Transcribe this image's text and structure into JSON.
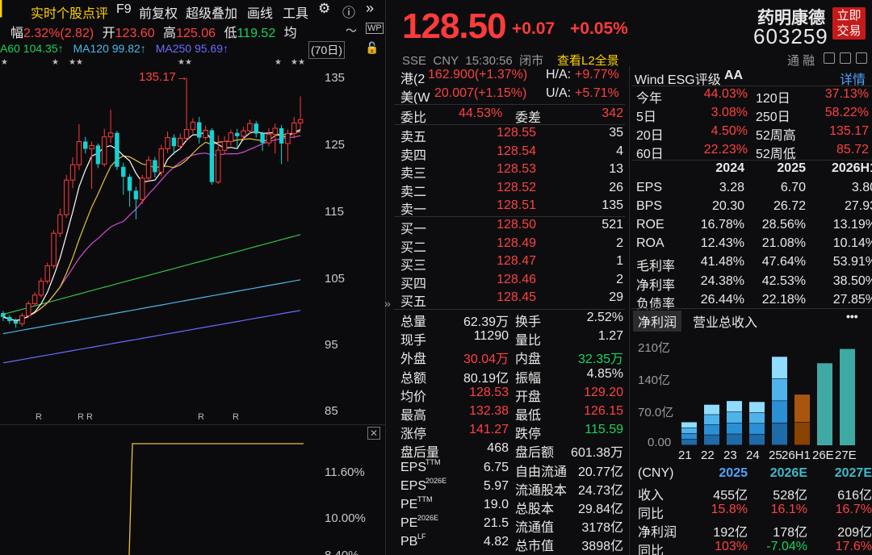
{
  "toolbar": {
    "items": [
      "实时个股点评",
      "F9",
      "前复权",
      "超级叠加",
      "画线",
      "工具"
    ]
  },
  "chart_info": {
    "change_label": "幅",
    "change_value": "2.32%(2.82)",
    "open_label": "开",
    "open_value": "123.60",
    "high_label": "高",
    "high_value": "125.06",
    "low_label": "低",
    "low_value": "119.52",
    "avg_label": "均",
    "ma60": "A60 104.35↑",
    "ma120": "MA120 99.82↑",
    "ma250": "MA250 95.69↑",
    "period": "(70日)",
    "annotation": "135.17→",
    "y_ticks": [
      "135",
      "125",
      "115",
      "105",
      "95",
      "85"
    ],
    "r_marks": [
      "R",
      "R",
      "R",
      "R",
      "R"
    ],
    "lower_ticks": [
      "11.60%",
      "10.00%",
      "8.40%"
    ],
    "star": "★",
    "star2": "★★",
    "colors": {
      "ma5": "#ffffff",
      "ma10": "#e8c23b",
      "ma20": "#d84cd8",
      "ma60": "#33c04a",
      "ma120": "#4ab8e8",
      "ma250": "#6a6aff",
      "up": "#ff3b3b",
      "down": "#16d1d1"
    }
  },
  "quote": {
    "price": "128.50",
    "change": "+0.07",
    "pct": "+0.05%",
    "name": "药明康德",
    "code": "603259",
    "trade_btn": "立即交易",
    "exchange": "SSE",
    "currency": "CNY",
    "time": "15:30:56",
    "status": "闭市",
    "l2": "查看L2全景",
    "tonghrong": "通 融",
    "hk_label": "港(2",
    "hk_value": "162.900(+1.37%)",
    "ha_label": "H/A:",
    "ha_value": "+9.77%",
    "us_label": "美(W",
    "us_value": "20.007(+1.15%)",
    "ua_label": "U/A:",
    "ua_value": "+5.71%",
    "weibi_label": "委比",
    "weibi_value": "44.53%",
    "weicha_label": "委差",
    "weicha_value": "342",
    "asks": [
      {
        "label": "卖五",
        "price": "128.55",
        "vol": "35"
      },
      {
        "label": "卖四",
        "price": "128.54",
        "vol": "4"
      },
      {
        "label": "卖三",
        "price": "128.53",
        "vol": "13"
      },
      {
        "label": "卖二",
        "price": "128.52",
        "vol": "26"
      },
      {
        "label": "卖一",
        "price": "128.51",
        "vol": "135"
      }
    ],
    "bids": [
      {
        "label": "买一",
        "price": "128.50",
        "vol": "521"
      },
      {
        "label": "买二",
        "price": "128.49",
        "vol": "2"
      },
      {
        "label": "买三",
        "price": "128.47",
        "vol": "1"
      },
      {
        "label": "买四",
        "price": "128.46",
        "vol": "2"
      },
      {
        "label": "买五",
        "price": "128.45",
        "vol": "29"
      }
    ],
    "stats": [
      {
        "l1": "总量",
        "v1": "62.39万",
        "c1": "white",
        "l2": "换手",
        "v2": "2.52%",
        "c2": "white"
      },
      {
        "l1": "现手",
        "v1": "11290",
        "c1": "white",
        "l2": "量比",
        "v2": "1.27",
        "c2": "white"
      },
      {
        "l1": "外盘",
        "v1": "30.04万",
        "c1": "red",
        "l2": "内盘",
        "v2": "32.35万",
        "c2": "green"
      },
      {
        "l1": "总额",
        "v1": "80.19亿",
        "c1": "white",
        "l2": "振幅",
        "v2": "4.85%",
        "c2": "white"
      },
      {
        "l1": "均价",
        "v1": "128.53",
        "c1": "red",
        "l2": "开盘",
        "v2": "129.20",
        "c2": "red"
      },
      {
        "l1": "最高",
        "v1": "132.38",
        "c1": "red",
        "l2": "最低",
        "v2": "126.15",
        "c2": "red"
      },
      {
        "l1": "涨停",
        "v1": "141.27",
        "c1": "red",
        "l2": "跌停",
        "v2": "115.59",
        "c2": "green"
      },
      {
        "l1": "盘后量",
        "v1": "468",
        "c1": "white",
        "l2": "盘后额",
        "v2": "601.38万",
        "c2": "white"
      },
      {
        "l1": "EPS",
        "s1": "TTM",
        "v1": "6.75",
        "c1": "white",
        "l2": "自由流通",
        "v2": "20.77亿",
        "c2": "white"
      },
      {
        "l1": "EPS",
        "s1": "2026E",
        "v1": "5.97",
        "c1": "white",
        "l2": "流通股本",
        "v2": "24.73亿",
        "c2": "white"
      },
      {
        "l1": "PE",
        "s1": "TTM",
        "v1": "19.0",
        "c1": "white",
        "l2": "总股本",
        "v2": "29.84亿",
        "c2": "white"
      },
      {
        "l1": "PE",
        "s1": "2026E",
        "v1": "21.5",
        "c1": "white",
        "l2": "流通值",
        "v2": "3178亿",
        "c2": "white"
      },
      {
        "l1": "PB",
        "s1": "LF",
        "v1": "4.82",
        "c1": "white",
        "l2": "总市值",
        "v2": "3898亿",
        "c2": "white"
      }
    ]
  },
  "fundamentals": {
    "esg_label": "Wind ESG评级",
    "esg_value": "AA",
    "detail": "详情",
    "returns": [
      {
        "l1": "今年",
        "v1": "44.03%",
        "l2": "120日",
        "v2": "37.13%"
      },
      {
        "l1": "5日",
        "v1": "3.08%",
        "l2": "250日",
        "v2": "58.22%"
      },
      {
        "l1": "20日",
        "v1": "4.50%",
        "l2": "52周高",
        "v2": "135.17"
      },
      {
        "l1": "60日",
        "v1": "22.23%",
        "l2": "52周低",
        "v2": "85.72"
      }
    ],
    "years": [
      "2024",
      "2025",
      "2026H1"
    ],
    "metrics": [
      {
        "label": "EPS",
        "vals": [
          "3.28",
          "6.70",
          "3.80"
        ]
      },
      {
        "label": "BPS",
        "vals": [
          "20.30",
          "26.72",
          "27.93"
        ]
      },
      {
        "label": "ROE",
        "vals": [
          "16.78%",
          "28.56%",
          "13.19%"
        ]
      },
      {
        "label": "ROA",
        "vals": [
          "12.43%",
          "21.08%",
          "10.14%"
        ]
      },
      {
        "label": "毛利率",
        "vals": [
          "41.48%",
          "47.64%",
          "53.91%"
        ]
      },
      {
        "label": "净利率",
        "vals": [
          "24.38%",
          "42.53%",
          "38.50%"
        ]
      },
      {
        "label": "负债率",
        "vals": [
          "26.44%",
          "22.18%",
          "27.85%"
        ]
      }
    ],
    "tabs": [
      "净利润",
      "营业总收入"
    ],
    "more": "•••",
    "chart_y": [
      "210亿",
      "140亿",
      "70.0亿",
      "0.00"
    ],
    "chart_x": [
      "21",
      "22",
      "23",
      "24",
      "25",
      "26H1",
      "26E",
      "27E"
    ],
    "forecast_head": [
      "(CNY)",
      "2025",
      "2026E",
      "2027E"
    ],
    "forecast_rows": [
      {
        "label": "收入",
        "vals": [
          "455亿",
          "528亿",
          "616亿"
        ],
        "colors": [
          "white",
          "white",
          "white"
        ]
      },
      {
        "label": "同比",
        "vals": [
          "15.8%",
          "16.1%",
          "16.7%"
        ],
        "colors": [
          "red",
          "red",
          "red"
        ]
      },
      {
        "label": "净利润",
        "vals": [
          "192亿",
          "178亿",
          "209亿"
        ],
        "colors": [
          "white",
          "white",
          "white"
        ]
      },
      {
        "label": "同比",
        "vals": [
          "103%",
          "-7.04%",
          "17.6%"
        ],
        "colors": [
          "red",
          "green",
          "red"
        ]
      }
    ]
  },
  "chart_data": [
    {
      "type": "candlestick",
      "title": "",
      "yticks": [
        135,
        125,
        115,
        105,
        95,
        85
      ],
      "ylim": [
        83,
        138
      ],
      "candles": [
        [
          99.8,
          99.2,
          100.1,
          98.6
        ],
        [
          99.2,
          98.6,
          99.5,
          98.2
        ],
        [
          98.6,
          98.2,
          99,
          97.6
        ],
        [
          98.2,
          99.4,
          99.8,
          97.8
        ],
        [
          99.4,
          101.2,
          101.6,
          99.1
        ],
        [
          101.2,
          102.5,
          102.9,
          100.8
        ],
        [
          102.5,
          104.6,
          105.1,
          102.1
        ],
        [
          104.6,
          106.9,
          107.4,
          104.2
        ],
        [
          106.9,
          111.8,
          112.3,
          106.5
        ],
        [
          111.8,
          114.6,
          115.5,
          111.2
        ],
        [
          114.6,
          119.8,
          120.6,
          114.1
        ],
        [
          119.8,
          122.1,
          123.2,
          118.6
        ],
        [
          122.1,
          125.6,
          128.2,
          121.3
        ],
        [
          125.6,
          124.5,
          126.3,
          123.8
        ],
        [
          124.5,
          125.0,
          125.6,
          118.5
        ],
        [
          125.0,
          122.2,
          125.3,
          121.6
        ],
        [
          122.2,
          126.3,
          127.5,
          121.8
        ],
        [
          126.3,
          126.9,
          130.4,
          125.4
        ],
        [
          126.9,
          121.8,
          127.2,
          121.3
        ],
        [
          121.8,
          120.3,
          122.4,
          117.6
        ],
        [
          120.3,
          118.2,
          120.7,
          115.8
        ],
        [
          118.2,
          116.9,
          118.8,
          113.9
        ],
        [
          116.9,
          120.1,
          120.6,
          116.2
        ],
        [
          120.1,
          122.8,
          123.4,
          119.6
        ],
        [
          122.8,
          121.0,
          123.3,
          120.2
        ],
        [
          121.0,
          124.5,
          125.1,
          120.4
        ],
        [
          124.5,
          126.2,
          127.1,
          123.9
        ],
        [
          126.2,
          124.9,
          126.7,
          123.6
        ],
        [
          124.9,
          126.1,
          126.8,
          124.4
        ],
        [
          126.1,
          127.4,
          135.17,
          125.6
        ],
        [
          127.4,
          128.5,
          129.1,
          126.8
        ],
        [
          128.5,
          126.2,
          129.3,
          125.3
        ],
        [
          126.2,
          127.3,
          128.0,
          125.8
        ],
        [
          127.3,
          119.5,
          127.6,
          119.1
        ],
        [
          119.5,
          124.3,
          126.5,
          119.2
        ],
        [
          124.3,
          125.6,
          126.4,
          123.7
        ],
        [
          125.6,
          126.9,
          127.4,
          125.0
        ],
        [
          126.9,
          126.4,
          127.5,
          124.8
        ],
        [
          126.4,
          127.2,
          127.8,
          125.7
        ],
        [
          127.2,
          128.3,
          128.9,
          126.8
        ],
        [
          128.3,
          126.8,
          128.7,
          126.2
        ],
        [
          126.8,
          125.4,
          127.1,
          124.2
        ],
        [
          125.4,
          126.7,
          127.6,
          124.9
        ],
        [
          126.7,
          127.6,
          128.3,
          123.8
        ],
        [
          127.6,
          125.3,
          128.1,
          122.2
        ],
        [
          125.3,
          126.8,
          127.4,
          122.6
        ],
        [
          126.8,
          128.4,
          129.3,
          126.1
        ],
        [
          128.4,
          128.9,
          132.4,
          127.4
        ]
      ]
    },
    {
      "type": "bar",
      "categories": [
        "21",
        "22",
        "23",
        "24",
        "25",
        "26H1",
        "26E",
        "27E"
      ],
      "values": [
        50,
        88,
        96,
        94,
        192,
        110,
        178,
        209
      ],
      "ylim": [
        0,
        210
      ]
    }
  ]
}
